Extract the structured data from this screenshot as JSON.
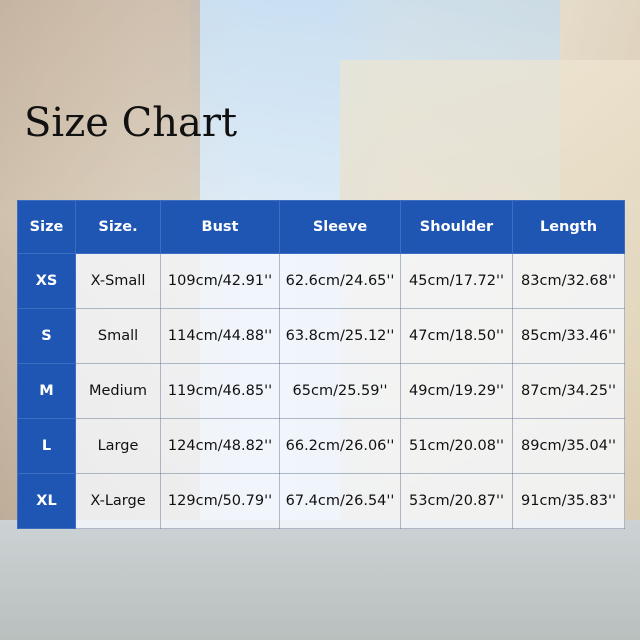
{
  "title": "Size Chart",
  "table": {
    "headers": [
      "Size",
      "Size.",
      "Bust",
      "Sleeve",
      "Shoulder",
      "Length"
    ],
    "rows": [
      [
        "XS",
        "X-Small",
        "109cm/42.91''",
        "62.6cm/24.65''",
        "45cm/17.72''",
        "83cm/32.68''"
      ],
      [
        "S",
        "Small",
        "114cm/44.88''",
        "63.8cm/25.12''",
        "47cm/18.50''",
        "85cm/33.46''"
      ],
      [
        "M",
        "Medium",
        "119cm/46.85''",
        "65cm/25.59''",
        "49cm/19.29''",
        "87cm/34.25''"
      ],
      [
        "L",
        "Large",
        "124cm/48.82''",
        "66.2cm/26.06''",
        "51cm/20.08''",
        "89cm/35.04''"
      ],
      [
        "XL",
        "X-Large",
        "129cm/50.79''",
        "67.4cm/26.54''",
        "53cm/20.87''",
        "91cm/35.83''"
      ]
    ]
  },
  "colors": {
    "header_blue": "#1f56b3"
  }
}
